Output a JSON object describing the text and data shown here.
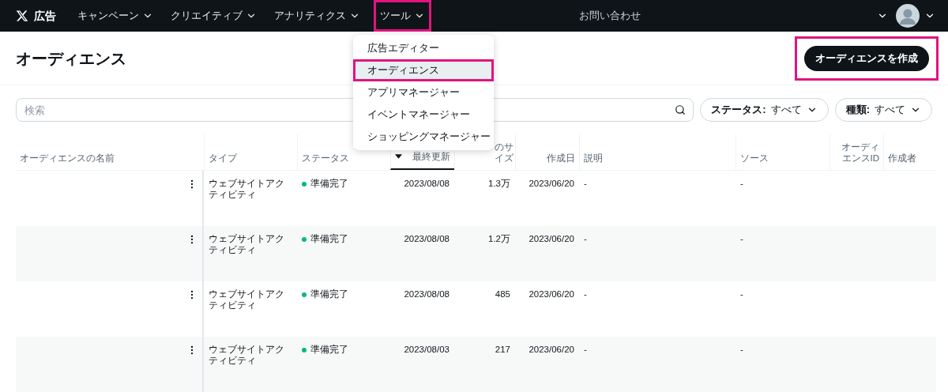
{
  "nav": {
    "logo": "広告",
    "items": [
      {
        "label": "キャンペーン",
        "highlighted": false
      },
      {
        "label": "クリエイティブ",
        "highlighted": false
      },
      {
        "label": "アナリティクス",
        "highlighted": false
      },
      {
        "label": "ツール",
        "highlighted": true
      }
    ],
    "help": "お問い合わせ"
  },
  "tools_menu": [
    {
      "label": "広告エディター",
      "selected": false,
      "highlighted": false
    },
    {
      "label": "オーディエンス",
      "selected": true,
      "highlighted": true
    },
    {
      "label": "アプリマネージャー",
      "selected": false,
      "highlighted": false
    },
    {
      "label": "イベントマネージャー",
      "selected": false,
      "highlighted": false
    },
    {
      "label": "ショッピングマネージャー",
      "selected": false,
      "highlighted": false
    }
  ],
  "page": {
    "title": "オーディエンス",
    "create_button": {
      "label": "オーディエンスを作成",
      "highlighted": true
    }
  },
  "search": {
    "placeholder": "検索"
  },
  "filters": [
    {
      "label": "ステータス:",
      "value": "すべて"
    },
    {
      "label": "種類:",
      "value": "すべて"
    }
  ],
  "table": {
    "columns": [
      {
        "label": "オーディエンスの名前",
        "sorted": false
      },
      {
        "label": "タイプ",
        "sorted": false
      },
      {
        "label": "ステータス",
        "sorted": false
      },
      {
        "label": "最終更新",
        "sorted": true
      },
      {
        "label": "のサイズ",
        "sorted": false
      },
      {
        "label": "作成日",
        "sorted": false
      },
      {
        "label": "説明",
        "sorted": false
      },
      {
        "label": "ソース",
        "sorted": false
      },
      {
        "label": "オーディエンスID",
        "sorted": false
      },
      {
        "label": "作成者",
        "sorted": false
      }
    ],
    "rows": [
      {
        "type": "ウェブサイトアクティビティ",
        "status": "準備完了",
        "last_updated": "2023/08/08",
        "size": "1.3万",
        "created": "2023/06/20",
        "description": "-",
        "source": "-"
      },
      {
        "type": "ウェブサイトアクティビティ",
        "status": "準備完了",
        "last_updated": "2023/08/08",
        "size": "1.2万",
        "created": "2023/06/20",
        "description": "-",
        "source": "-"
      },
      {
        "type": "ウェブサイトアクティビティ",
        "status": "準備完了",
        "last_updated": "2023/08/08",
        "size": "485",
        "created": "2023/06/20",
        "description": "-",
        "source": "-"
      },
      {
        "type": "ウェブサイトアクティビティ",
        "status": "準備完了",
        "last_updated": "2023/08/03",
        "size": "217",
        "created": "2023/06/20",
        "description": "-",
        "source": "-"
      }
    ]
  }
}
